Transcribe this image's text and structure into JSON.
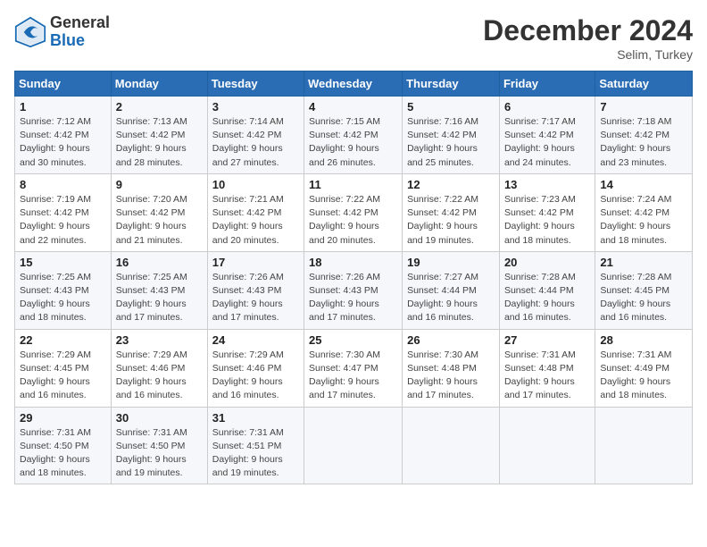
{
  "header": {
    "logo_general": "General",
    "logo_blue": "Blue",
    "month_title": "December 2024",
    "location": "Selim, Turkey"
  },
  "days_of_week": [
    "Sunday",
    "Monday",
    "Tuesday",
    "Wednesday",
    "Thursday",
    "Friday",
    "Saturday"
  ],
  "weeks": [
    [
      {
        "day": "1",
        "sunrise": "7:12 AM",
        "sunset": "4:42 PM",
        "daylight": "9 hours and 30 minutes."
      },
      {
        "day": "2",
        "sunrise": "7:13 AM",
        "sunset": "4:42 PM",
        "daylight": "9 hours and 28 minutes."
      },
      {
        "day": "3",
        "sunrise": "7:14 AM",
        "sunset": "4:42 PM",
        "daylight": "9 hours and 27 minutes."
      },
      {
        "day": "4",
        "sunrise": "7:15 AM",
        "sunset": "4:42 PM",
        "daylight": "9 hours and 26 minutes."
      },
      {
        "day": "5",
        "sunrise": "7:16 AM",
        "sunset": "4:42 PM",
        "daylight": "9 hours and 25 minutes."
      },
      {
        "day": "6",
        "sunrise": "7:17 AM",
        "sunset": "4:42 PM",
        "daylight": "9 hours and 24 minutes."
      },
      {
        "day": "7",
        "sunrise": "7:18 AM",
        "sunset": "4:42 PM",
        "daylight": "9 hours and 23 minutes."
      }
    ],
    [
      {
        "day": "8",
        "sunrise": "7:19 AM",
        "sunset": "4:42 PM",
        "daylight": "9 hours and 22 minutes."
      },
      {
        "day": "9",
        "sunrise": "7:20 AM",
        "sunset": "4:42 PM",
        "daylight": "9 hours and 21 minutes."
      },
      {
        "day": "10",
        "sunrise": "7:21 AM",
        "sunset": "4:42 PM",
        "daylight": "9 hours and 20 minutes."
      },
      {
        "day": "11",
        "sunrise": "7:22 AM",
        "sunset": "4:42 PM",
        "daylight": "9 hours and 20 minutes."
      },
      {
        "day": "12",
        "sunrise": "7:22 AM",
        "sunset": "4:42 PM",
        "daylight": "9 hours and 19 minutes."
      },
      {
        "day": "13",
        "sunrise": "7:23 AM",
        "sunset": "4:42 PM",
        "daylight": "9 hours and 18 minutes."
      },
      {
        "day": "14",
        "sunrise": "7:24 AM",
        "sunset": "4:42 PM",
        "daylight": "9 hours and 18 minutes."
      }
    ],
    [
      {
        "day": "15",
        "sunrise": "7:25 AM",
        "sunset": "4:43 PM",
        "daylight": "9 hours and 18 minutes."
      },
      {
        "day": "16",
        "sunrise": "7:25 AM",
        "sunset": "4:43 PM",
        "daylight": "9 hours and 17 minutes."
      },
      {
        "day": "17",
        "sunrise": "7:26 AM",
        "sunset": "4:43 PM",
        "daylight": "9 hours and 17 minutes."
      },
      {
        "day": "18",
        "sunrise": "7:26 AM",
        "sunset": "4:43 PM",
        "daylight": "9 hours and 17 minutes."
      },
      {
        "day": "19",
        "sunrise": "7:27 AM",
        "sunset": "4:44 PM",
        "daylight": "9 hours and 16 minutes."
      },
      {
        "day": "20",
        "sunrise": "7:28 AM",
        "sunset": "4:44 PM",
        "daylight": "9 hours and 16 minutes."
      },
      {
        "day": "21",
        "sunrise": "7:28 AM",
        "sunset": "4:45 PM",
        "daylight": "9 hours and 16 minutes."
      }
    ],
    [
      {
        "day": "22",
        "sunrise": "7:29 AM",
        "sunset": "4:45 PM",
        "daylight": "9 hours and 16 minutes."
      },
      {
        "day": "23",
        "sunrise": "7:29 AM",
        "sunset": "4:46 PM",
        "daylight": "9 hours and 16 minutes."
      },
      {
        "day": "24",
        "sunrise": "7:29 AM",
        "sunset": "4:46 PM",
        "daylight": "9 hours and 16 minutes."
      },
      {
        "day": "25",
        "sunrise": "7:30 AM",
        "sunset": "4:47 PM",
        "daylight": "9 hours and 17 minutes."
      },
      {
        "day": "26",
        "sunrise": "7:30 AM",
        "sunset": "4:48 PM",
        "daylight": "9 hours and 17 minutes."
      },
      {
        "day": "27",
        "sunrise": "7:31 AM",
        "sunset": "4:48 PM",
        "daylight": "9 hours and 17 minutes."
      },
      {
        "day": "28",
        "sunrise": "7:31 AM",
        "sunset": "4:49 PM",
        "daylight": "9 hours and 18 minutes."
      }
    ],
    [
      {
        "day": "29",
        "sunrise": "7:31 AM",
        "sunset": "4:50 PM",
        "daylight": "9 hours and 18 minutes."
      },
      {
        "day": "30",
        "sunrise": "7:31 AM",
        "sunset": "4:50 PM",
        "daylight": "9 hours and 19 minutes."
      },
      {
        "day": "31",
        "sunrise": "7:31 AM",
        "sunset": "4:51 PM",
        "daylight": "9 hours and 19 minutes."
      },
      null,
      null,
      null,
      null
    ]
  ]
}
